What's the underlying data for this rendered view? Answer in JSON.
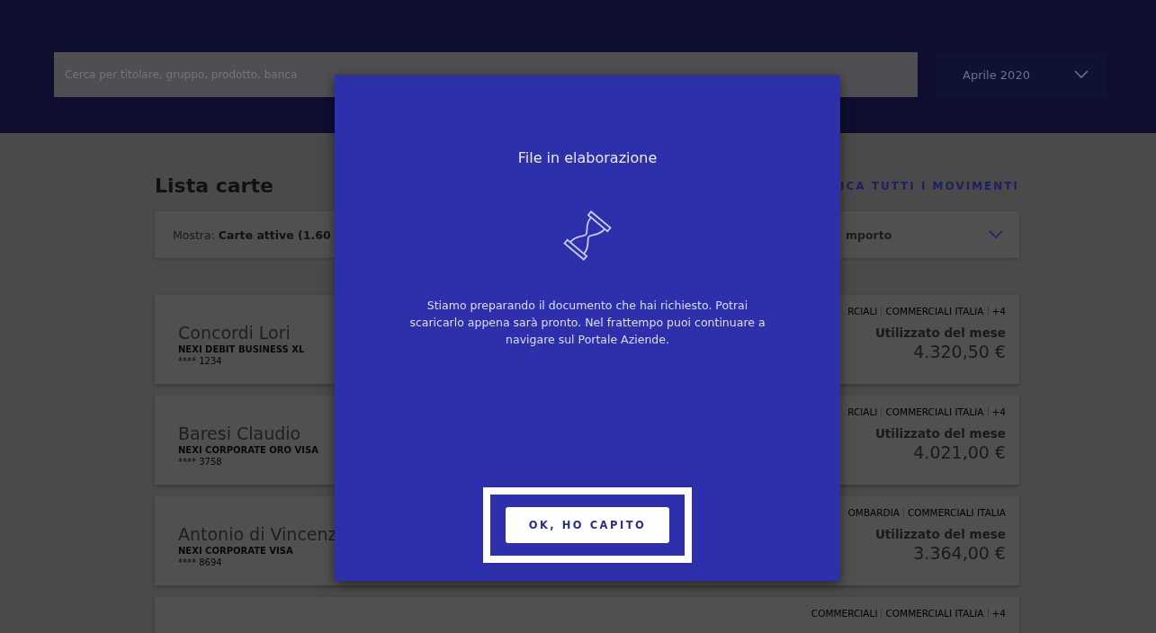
{
  "header": {
    "search": {
      "placeholder": "Cerca per titolare, gruppo, prodotto, banca"
    },
    "month": {
      "value": "Aprile 2020"
    }
  },
  "list": {
    "title": "Lista carte",
    "link": "ICA TUTTI I MOVIMENTI",
    "filter": "Mostra: **Carte attive (1.60**",
    "sort": "mporto",
    "cards": [
      {
        "name": "Concordi Lori",
        "product": "NEXI DEBIT BUSINESS XL",
        "number": "**** 1234",
        "tags": [
          "RCIALI",
          "COMMERCIALI ITALIA",
          "+4"
        ],
        "amount_label": "Utilizzato del mese",
        "amount": "4.320,50 €"
      },
      {
        "name": "Baresi Claudio",
        "product": "NEXI CORPORATE ORO VISA",
        "number": "**** 3758",
        "tags": [
          "RCIALI",
          "COMMERCIALI ITALIA",
          "+4"
        ],
        "amount_label": "Utilizzato del mese",
        "amount": "4.021,00 €"
      },
      {
        "name": "Antonio di Vincenz",
        "product": "NEXI CORPORATE VISA",
        "number": "**** 8694",
        "tags": [
          "OMBARDIA",
          "COMMERCIALI ITALIA"
        ],
        "amount_label": "Utilizzato del mese",
        "amount": "3.364,00 €"
      },
      {
        "tags": [
          "COMMERCIALI",
          "COMMERCIALI ITALIA",
          "+4"
        ]
      }
    ]
  },
  "dialog": {
    "title": "File in elaborazione",
    "message": "Stiamo preparando il documento che hai richiesto. Potrai scaricarlo appena sarà pronto. Nel frattempo puoi continuare a navigare sul Portale Aziende.",
    "button": "OK, HO CAPITO",
    "button_highlighted": true
  }
}
